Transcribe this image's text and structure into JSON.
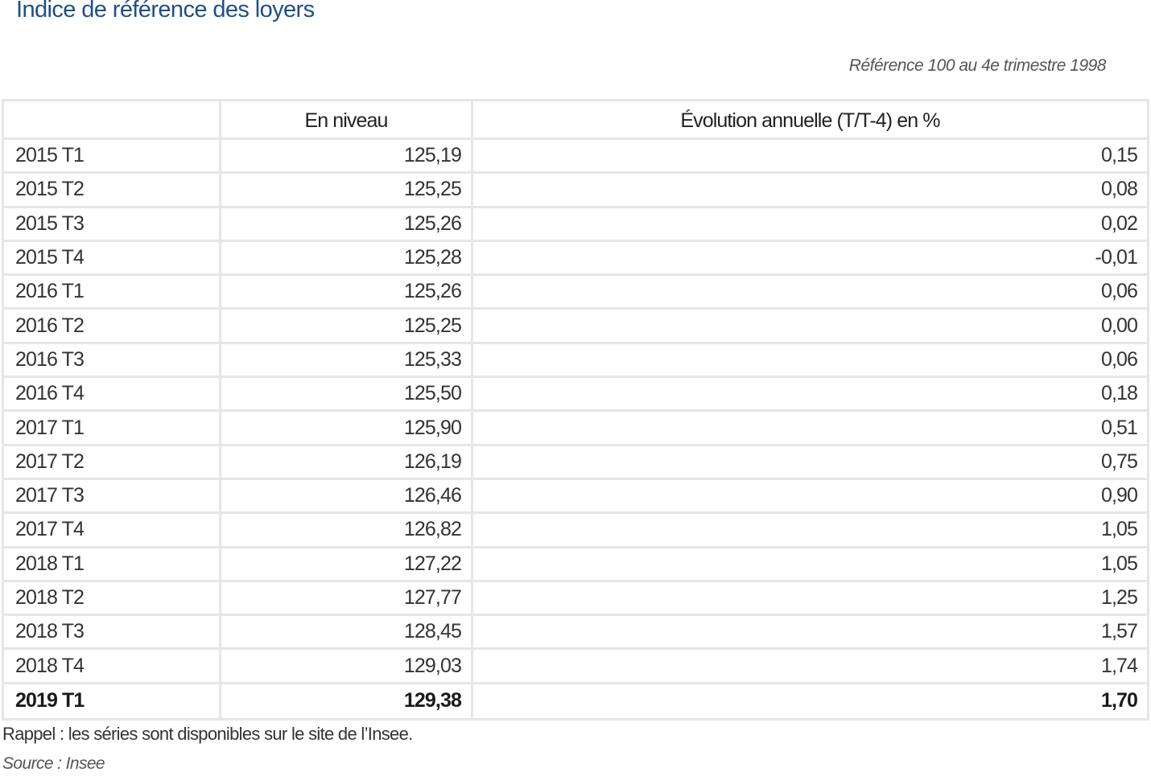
{
  "title": "Indice de référence des loyers",
  "reference_note": "Référence 100 au 4e trimestre 1998",
  "table": {
    "headers": [
      "",
      "En niveau",
      "Évolution annuelle (T/T-4) en %"
    ],
    "rows": [
      {
        "period": "2015 T1",
        "level": "125,19",
        "change": "0,15"
      },
      {
        "period": "2015 T2",
        "level": "125,25",
        "change": "0,08"
      },
      {
        "period": "2015 T3",
        "level": "125,26",
        "change": "0,02"
      },
      {
        "period": "2015 T4",
        "level": "125,28",
        "change": "-0,01"
      },
      {
        "period": "2016 T1",
        "level": "125,26",
        "change": "0,06"
      },
      {
        "period": "2016 T2",
        "level": "125,25",
        "change": "0,00"
      },
      {
        "period": "2016 T3",
        "level": "125,33",
        "change": "0,06"
      },
      {
        "period": "2016 T4",
        "level": "125,50",
        "change": "0,18"
      },
      {
        "period": "2017 T1",
        "level": "125,90",
        "change": "0,51"
      },
      {
        "period": "2017 T2",
        "level": "126,19",
        "change": "0,75"
      },
      {
        "period": "2017 T3",
        "level": "126,46",
        "change": "0,90"
      },
      {
        "period": "2017 T4",
        "level": "126,82",
        "change": "1,05"
      },
      {
        "period": "2018 T1",
        "level": "127,22",
        "change": "1,05"
      },
      {
        "period": "2018 T2",
        "level": "127,77",
        "change": "1,25"
      },
      {
        "period": "2018 T3",
        "level": "128,45",
        "change": "1,57"
      },
      {
        "period": "2018 T4",
        "level": "129,03",
        "change": "1,74"
      },
      {
        "period": "2019 T1",
        "level": "129,38",
        "change": "1,70"
      }
    ]
  },
  "footnote": "Rappel : les séries sont disponibles sur le site de l’Insee.",
  "source": "Source : Insee",
  "colors": {
    "title": "#1f4f86",
    "border": "#e6e6e6",
    "text": "#333333"
  }
}
